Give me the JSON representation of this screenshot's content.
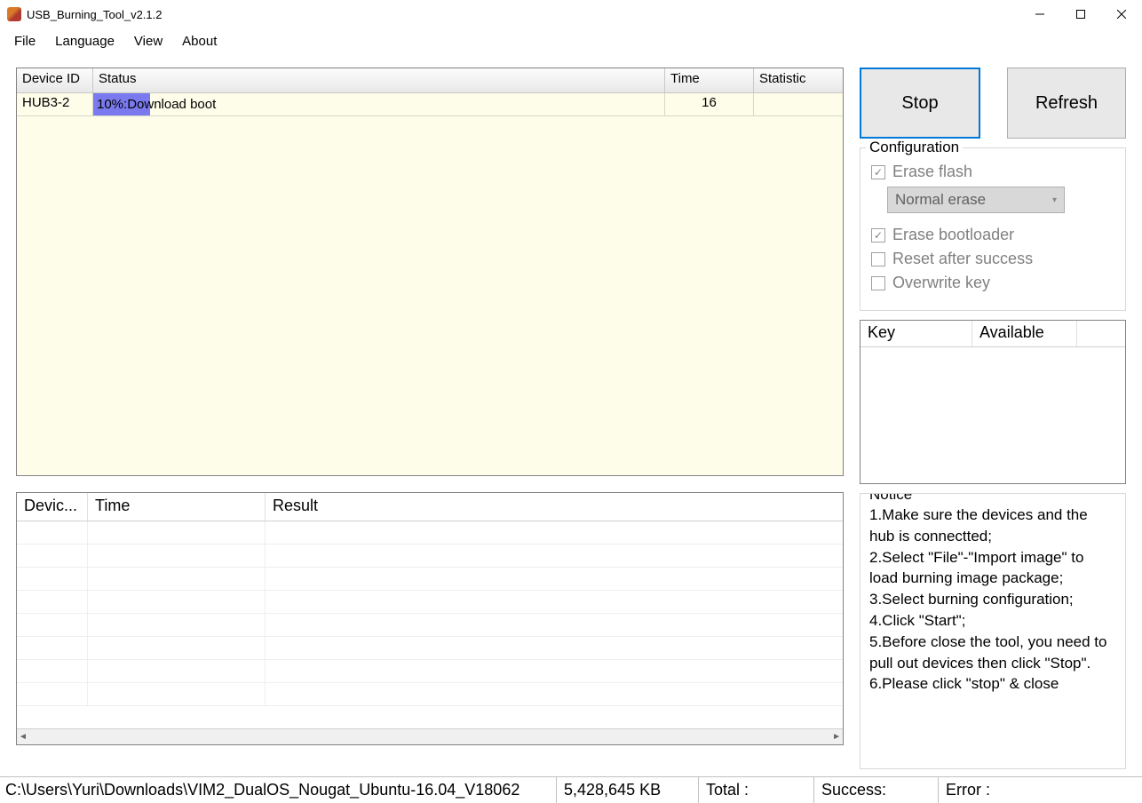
{
  "window": {
    "title": "USB_Burning_Tool_v2.1.2"
  },
  "menu": {
    "file": "File",
    "language": "Language",
    "view": "View",
    "about": "About"
  },
  "deviceTable": {
    "headers": {
      "id": "Device ID",
      "status": "Status",
      "time": "Time",
      "stat": "Statistic"
    },
    "row": {
      "id": "HUB3-2",
      "percent": 10,
      "statusText": "10%:Download boot",
      "time": "16",
      "stat": ""
    }
  },
  "resultTable": {
    "headers": {
      "device": "Devic...",
      "time": "Time",
      "result": "Result"
    }
  },
  "buttons": {
    "stop": "Stop",
    "refresh": "Refresh"
  },
  "config": {
    "title": "Configuration",
    "eraseFlash": "Erase flash",
    "eraseMode": "Normal erase",
    "eraseBootloader": "Erase bootloader",
    "resetAfter": "Reset after success",
    "overwriteKey": "Overwrite key"
  },
  "keyTable": {
    "headers": {
      "key": "Key",
      "available": "Available"
    }
  },
  "notice": {
    "title": "Notice",
    "l1": "1.Make sure the devices and the hub is connectted;",
    "l2": "2.Select \"File\"-\"Import image\" to load burning image package;",
    "l3": "3.Select burning configuration;",
    "l4": "4.Click \"Start\";",
    "l5": "5.Before close the tool, you need to pull out devices then click \"Stop\".",
    "l6": "6.Please click \"stop\" & close"
  },
  "statusbar": {
    "path": "C:\\Users\\Yuri\\Downloads\\VIM2_DualOS_Nougat_Ubuntu-16.04_V18062",
    "size": "5,428,645 KB",
    "total": "Total :",
    "success": "Success:",
    "error": "Error :"
  }
}
